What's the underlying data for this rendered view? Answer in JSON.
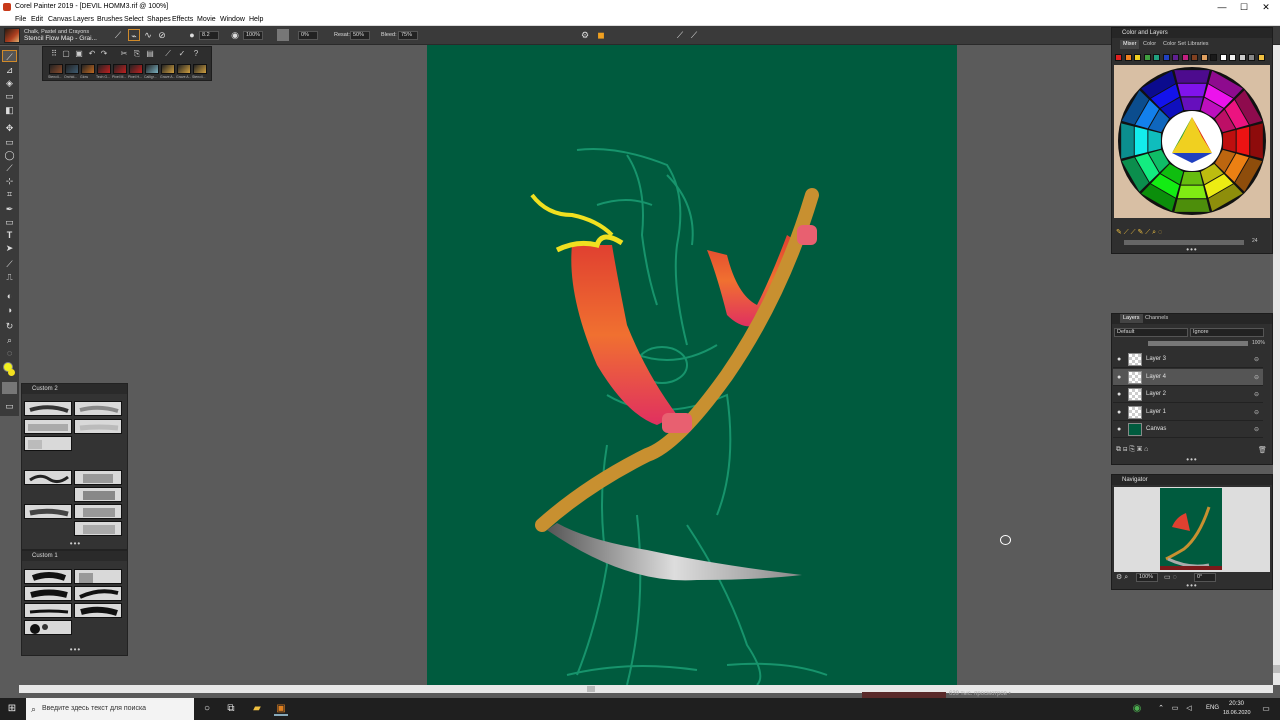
{
  "window": {
    "title": "Corel Painter 2019 - [DEVIL HOMM3.rif @ 100%]",
    "controls": [
      "—",
      "☐",
      "✕"
    ]
  },
  "menu": [
    "File",
    "Edit",
    "Canvas",
    "Layers",
    "Brushes",
    "Select",
    "Shapes",
    "Effects",
    "Movie",
    "Window",
    "Help"
  ],
  "propbar": {
    "brush_category": "Chalk, Pastel and Crayons",
    "brush_variant": "Stencil Flow Map - Grai...",
    "size": "8.2",
    "opacity": "100%",
    "grain": "0%",
    "resat_label": "Resat:",
    "resat": "50%",
    "bleed_label": "Bleed:",
    "bleed": "75%"
  },
  "brush_library": {
    "labels": [
      "Stencil...",
      "Orchid...",
      "Glow",
      "Tech G...",
      "Pixel M...",
      "Pixel H...",
      "Calligr...",
      "Grave A...",
      "Grave A...",
      "Stencil..."
    ],
    "colors": [
      "#8a4a2a",
      "#3d5a70",
      "#c06820",
      "#c02020",
      "#c02020",
      "#c02020",
      "#7ab0c0",
      "#d0a040",
      "#d0a040",
      "#d0a040"
    ]
  },
  "palettes": {
    "custom2": "Custom 2",
    "custom1": "Custom 1",
    "dots": "•••"
  },
  "color_panel": {
    "title": "Color and Layers",
    "tabs": [
      "Mixer",
      "Color",
      "Color Set Libraries"
    ],
    "chips": [
      "#e02020",
      "#f08020",
      "#f0d020",
      "#40a040",
      "#20a080",
      "#2040c0",
      "#602090",
      "#c02080",
      "#804020",
      "#e0a060",
      "#1a1a1a",
      "#ffffff",
      "#f0f0f0",
      "#cccccc",
      "#888888",
      "#f0c040"
    ],
    "value": "24",
    "dots": "•••"
  },
  "layers_panel": {
    "tabs": [
      "Layers",
      "Channels"
    ],
    "composite": "Default",
    "method": "Ignore",
    "opacity": "100%",
    "layers": [
      {
        "name": "Layer 3",
        "selected": false
      },
      {
        "name": "Layer 4",
        "selected": true
      },
      {
        "name": "Layer 2",
        "selected": false
      },
      {
        "name": "Layer 1",
        "selected": false
      },
      {
        "name": "Canvas",
        "selected": false
      }
    ],
    "dots": "•••"
  },
  "navigator": {
    "title": "Navigator",
    "zoom": "100%",
    "rotation": "0°",
    "dots": "•••"
  },
  "video_overlay": "639 тыс. просмотров •",
  "taskbar": {
    "search_placeholder": "Введите здесь текст для поиска",
    "lang": "ENG",
    "time": "20:30",
    "date": "18.06.2020"
  }
}
